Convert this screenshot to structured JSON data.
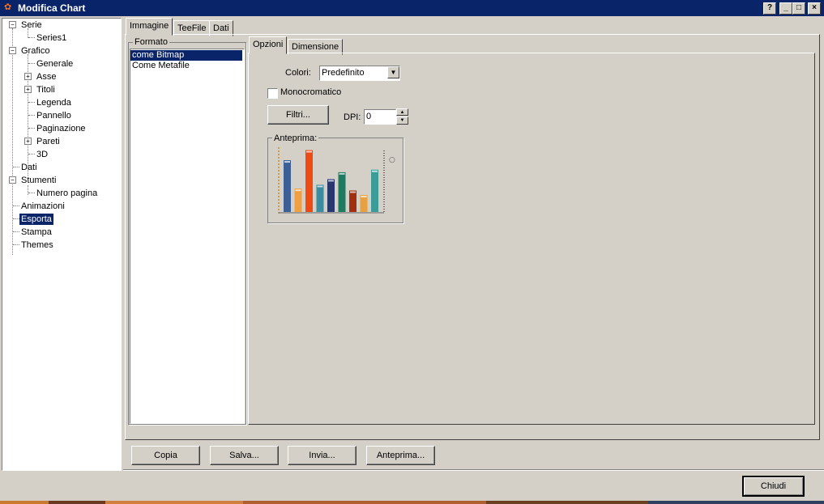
{
  "window": {
    "title": "Modifica Chart"
  },
  "tree": {
    "items": [
      {
        "label": "Serie"
      },
      {
        "label": "Series1"
      },
      {
        "label": "Grafico"
      },
      {
        "label": "Generale"
      },
      {
        "label": "Asse"
      },
      {
        "label": "Titoli"
      },
      {
        "label": "Legenda"
      },
      {
        "label": "Pannello"
      },
      {
        "label": "Paginazione"
      },
      {
        "label": "Pareti"
      },
      {
        "label": "3D"
      },
      {
        "label": "Dati"
      },
      {
        "label": "Stumenti"
      },
      {
        "label": "Numero pagina"
      },
      {
        "label": "Animazioni"
      },
      {
        "label": "Esporta"
      },
      {
        "label": "Stampa"
      },
      {
        "label": "Themes"
      }
    ],
    "selected": "Esporta"
  },
  "main_tabs": [
    "Immagine",
    "TeeFile",
    "Dati"
  ],
  "formato": {
    "label": "Formato",
    "items": [
      "come Bitmap",
      "Come Metafile"
    ],
    "selected": "come Bitmap"
  },
  "sub_tabs": [
    "Opzioni",
    "Dimensione"
  ],
  "opzioni": {
    "colori_label": "Colori:",
    "colori_value": "Predefinito",
    "monocromatico_label": "Monocromatico",
    "monocromatico_checked": false,
    "filtri_label": "Filtri...",
    "dpi_label": "DPI:",
    "dpi_value": "0",
    "anteprima_label": "Anteprima:"
  },
  "preview_bars": [
    {
      "value": 0.82,
      "color": "#3c5f96"
    },
    {
      "value": 0.37,
      "color": "#f0a040"
    },
    {
      "value": 0.98,
      "color": "#f04a14"
    },
    {
      "value": 0.43,
      "color": "#3c8ca0"
    },
    {
      "value": 0.52,
      "color": "#28386e"
    },
    {
      "value": 0.63,
      "color": "#1e7a60"
    },
    {
      "value": 0.34,
      "color": "#a03010"
    },
    {
      "value": 0.27,
      "color": "#e8a040"
    },
    {
      "value": 0.67,
      "color": "#3c9c98"
    }
  ],
  "buttons": {
    "copia": "Copia",
    "salva": "Salva...",
    "invia": "Invia...",
    "anteprima": "Anteprima...",
    "chiudi": "Chiudi"
  }
}
